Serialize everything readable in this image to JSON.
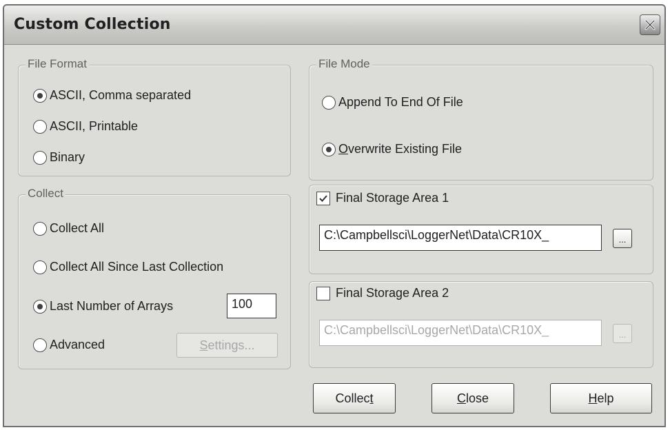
{
  "window": {
    "title": "Custom Collection"
  },
  "file_format": {
    "legend": "File Format",
    "options": [
      {
        "label": "ASCII, Comma separated",
        "checked": true
      },
      {
        "label": "ASCII, Printable",
        "checked": false
      },
      {
        "label": "Binary",
        "checked": false
      }
    ]
  },
  "collect": {
    "legend": "Collect",
    "options": [
      {
        "label": "Collect All",
        "checked": false
      },
      {
        "label": "Collect All Since Last Collection",
        "checked": false
      },
      {
        "label": "Last Number of Arrays",
        "checked": true
      },
      {
        "label": "Advanced",
        "checked": false
      }
    ],
    "arrays_value": "100",
    "settings_button": {
      "label_pre": "",
      "label_key": "S",
      "label_post": "ettings..."
    }
  },
  "file_mode": {
    "legend": "File Mode",
    "options": [
      {
        "label": "Append To End Of File",
        "checked": false
      },
      {
        "label_key": "O",
        "label_post": "verwrite Existing File",
        "checked": true
      }
    ]
  },
  "storage1": {
    "label": "Final Storage Area 1",
    "checked": true,
    "path": "C:\\Campbellsci\\LoggerNet\\Data\\CR10X_",
    "browse": "..."
  },
  "storage2": {
    "label": "Final Storage Area 2",
    "checked": false,
    "path": "C:\\Campbellsci\\LoggerNet\\Data\\CR10X_",
    "browse": "..."
  },
  "buttons": {
    "collect": {
      "pre": "Collec",
      "key": "t",
      "post": ""
    },
    "close": {
      "pre": "",
      "key": "C",
      "post": "lose"
    },
    "help": {
      "pre": "",
      "key": "H",
      "post": "elp"
    }
  }
}
